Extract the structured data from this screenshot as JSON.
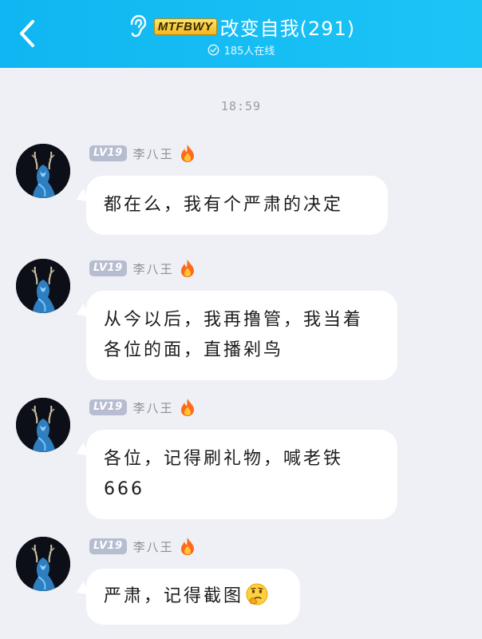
{
  "header": {
    "group_tag": "MTFBWY",
    "group_name": "改变自我(291)",
    "online_text": "185人在线",
    "back_icon": "chevron-left-icon",
    "ear_icon": "ear-icon",
    "online_icon": "check-circle-icon",
    "bg_color": "#13bcf3"
  },
  "chat": {
    "timestamp": "18:59",
    "messages": [
      {
        "level": "LV19",
        "username": "李八王",
        "badge_icon": "fire-icon",
        "text": "都在么，我有个严肃的决定"
      },
      {
        "level": "LV19",
        "username": "李八王",
        "badge_icon": "fire-icon",
        "text": "从今以后，我再撸管，我当着各位的面，直播剁鸟"
      },
      {
        "level": "LV19",
        "username": "李八王",
        "badge_icon": "fire-icon",
        "text": "各位，记得刷礼物，喊老铁666"
      },
      {
        "level": "LV19",
        "username": "李八王",
        "badge_icon": "fire-icon",
        "text": "严肃，记得截图",
        "emoji": "thinking-face-icon"
      }
    ]
  }
}
